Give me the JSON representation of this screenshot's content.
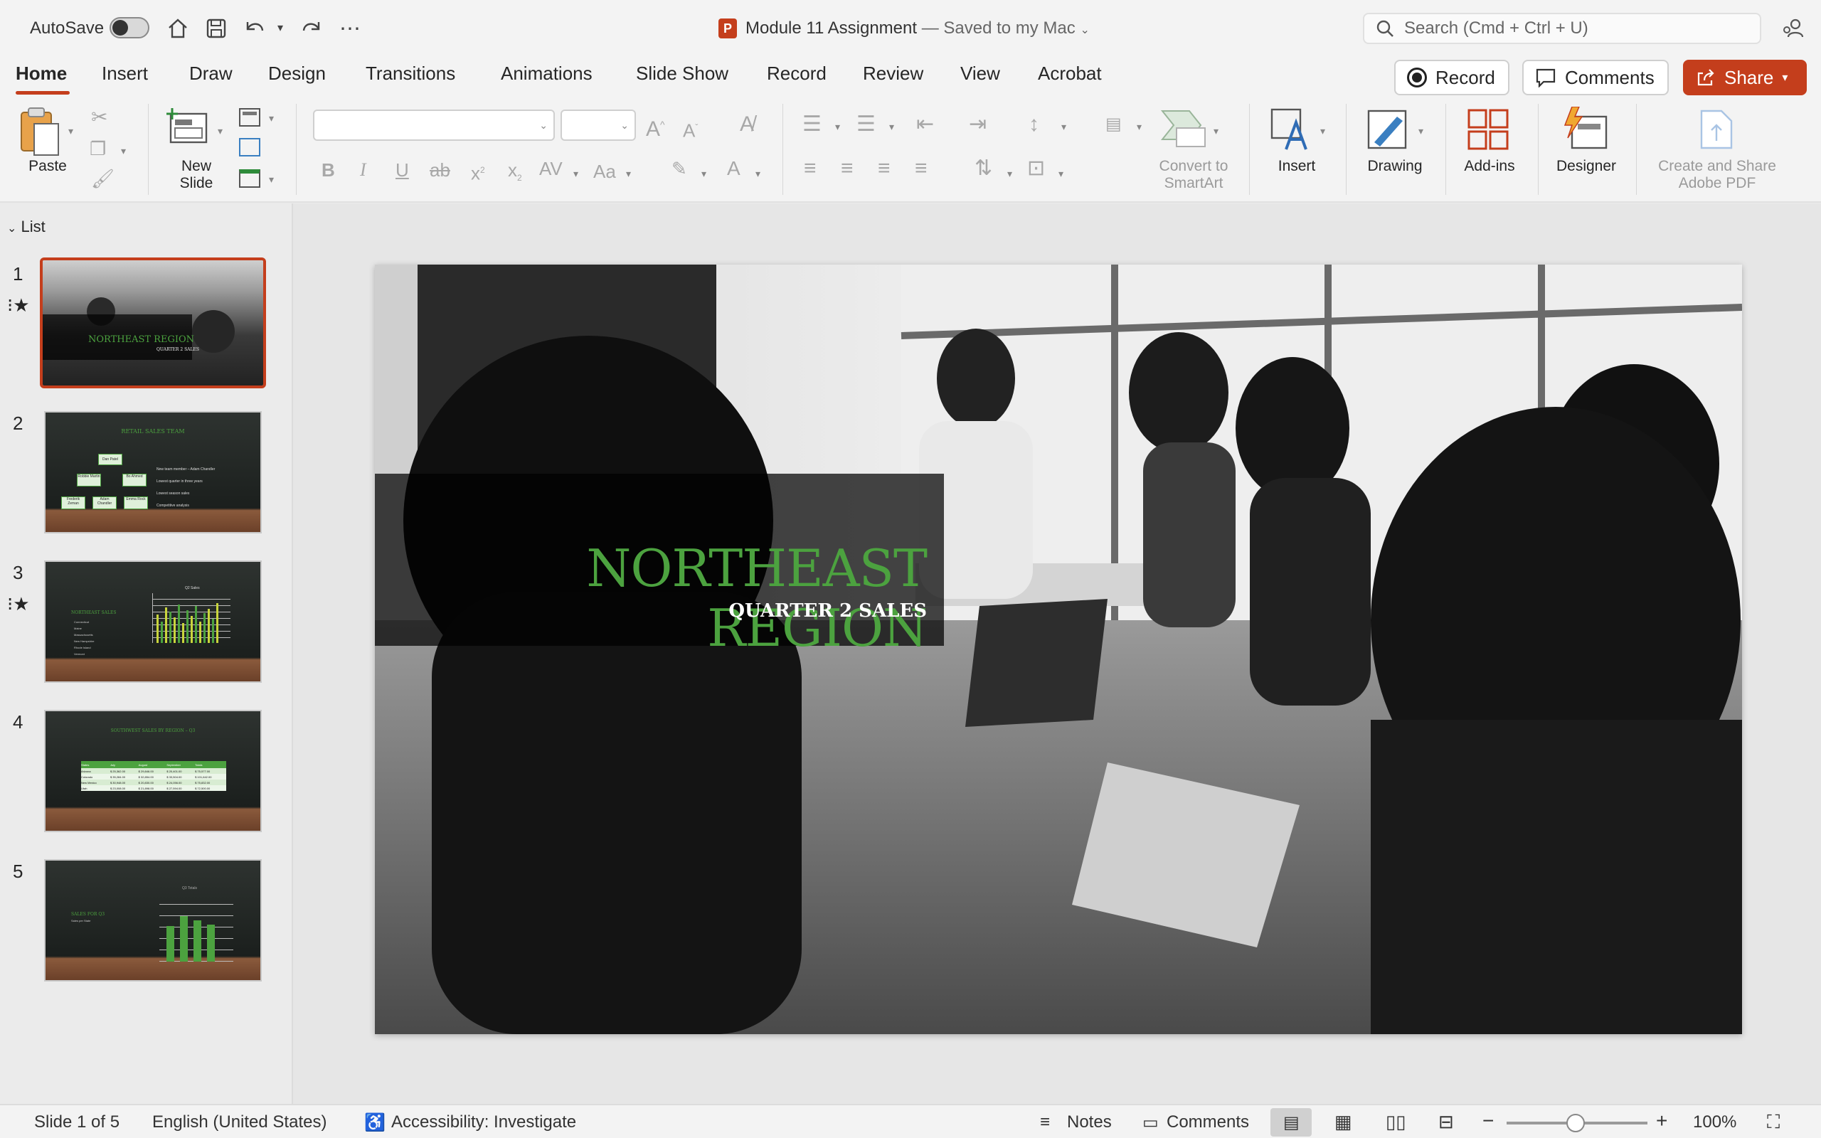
{
  "titlebar": {
    "autosave_label": "AutoSave",
    "doc_title": "Module 11 Assignment",
    "saved_status": "— Saved to my Mac",
    "search_placeholder": "Search (Cmd + Ctrl + U)"
  },
  "tabs": [
    "Home",
    "Insert",
    "Draw",
    "Design",
    "Transitions",
    "Animations",
    "Slide Show",
    "Record",
    "Review",
    "View",
    "Acrobat"
  ],
  "actions": {
    "record": "Record",
    "comments": "Comments",
    "share": "Share"
  },
  "ribbon": {
    "paste": "Paste",
    "new_slide_1": "New",
    "new_slide_2": "Slide",
    "convert_1": "Convert to",
    "convert_2": "SmartArt",
    "insert": "Insert",
    "drawing": "Drawing",
    "addins": "Add-ins",
    "designer": "Designer",
    "create_pdf_1": "Create and Share",
    "create_pdf_2": "Adobe PDF",
    "font_name": "",
    "font_size": ""
  },
  "panel": {
    "list_label": "List",
    "thumbnails": [
      {
        "num": "1",
        "title": "NORTHEAST REGION",
        "sub": "QUARTER 2 SALES",
        "star": true
      },
      {
        "num": "2",
        "title": "RETAIL SALES TEAM",
        "star": false,
        "bullets": [
          "New team member – Adam Chandler",
          "Lowest quarter in three years",
          "Lowest season sales",
          "Competitive analysis"
        ],
        "boxes": [
          "Dan Patel",
          "Robbie Martin",
          "Bo Ahmed",
          "Frederik Zeman",
          "Adam Chandler",
          "Emma Rock"
        ]
      },
      {
        "num": "3",
        "title": "NORTHEAST SALES",
        "chart_title": "Q2 Sales",
        "star": true,
        "items": [
          "Connecticut",
          "Maine",
          "Massachusetts",
          "New Hampshire",
          "Rhode Island",
          "Vermont"
        ]
      },
      {
        "num": "4",
        "title": "SOUTHWEST SALES BY REGION – Q3",
        "star": false,
        "table_header": [
          "States",
          "July",
          "August",
          "September",
          "Totals"
        ],
        "table_rows": [
          [
            "Arizona",
            "$ 25,362.00",
            "$ 29,846.00",
            "$ 20,401.00",
            "$ 75,577.00"
          ],
          [
            "Colorado",
            "$ 35,284.00",
            "$ 32,854.00",
            "$ 33,504.00",
            "$ 101,642.00"
          ],
          [
            "New Mexico",
            "$ 30,948.00",
            "$ 20,830.00",
            "$ 24,056.00",
            "$ 75,832.00"
          ],
          [
            "Utah",
            "$ 23,008.00",
            "$ 21,898.00",
            "$ 27,594.00",
            "$ 72,500.00"
          ]
        ]
      },
      {
        "num": "5",
        "title": "SALES FOR Q3",
        "sub": "Sales per State",
        "chart_title": "Q3 Totals",
        "star": false
      }
    ]
  },
  "slide": {
    "title": "NORTHEAST REGION",
    "subtitle": "QUARTER 2 SALES"
  },
  "status": {
    "slide_of": "Slide 1 of 5",
    "language": "English (United States)",
    "accessibility": "Accessibility: Investigate",
    "notes": "Notes",
    "comments": "Comments",
    "zoom": "100%"
  },
  "colors": {
    "accent": "#c43e1c",
    "slide_title": "#4ca23f"
  }
}
